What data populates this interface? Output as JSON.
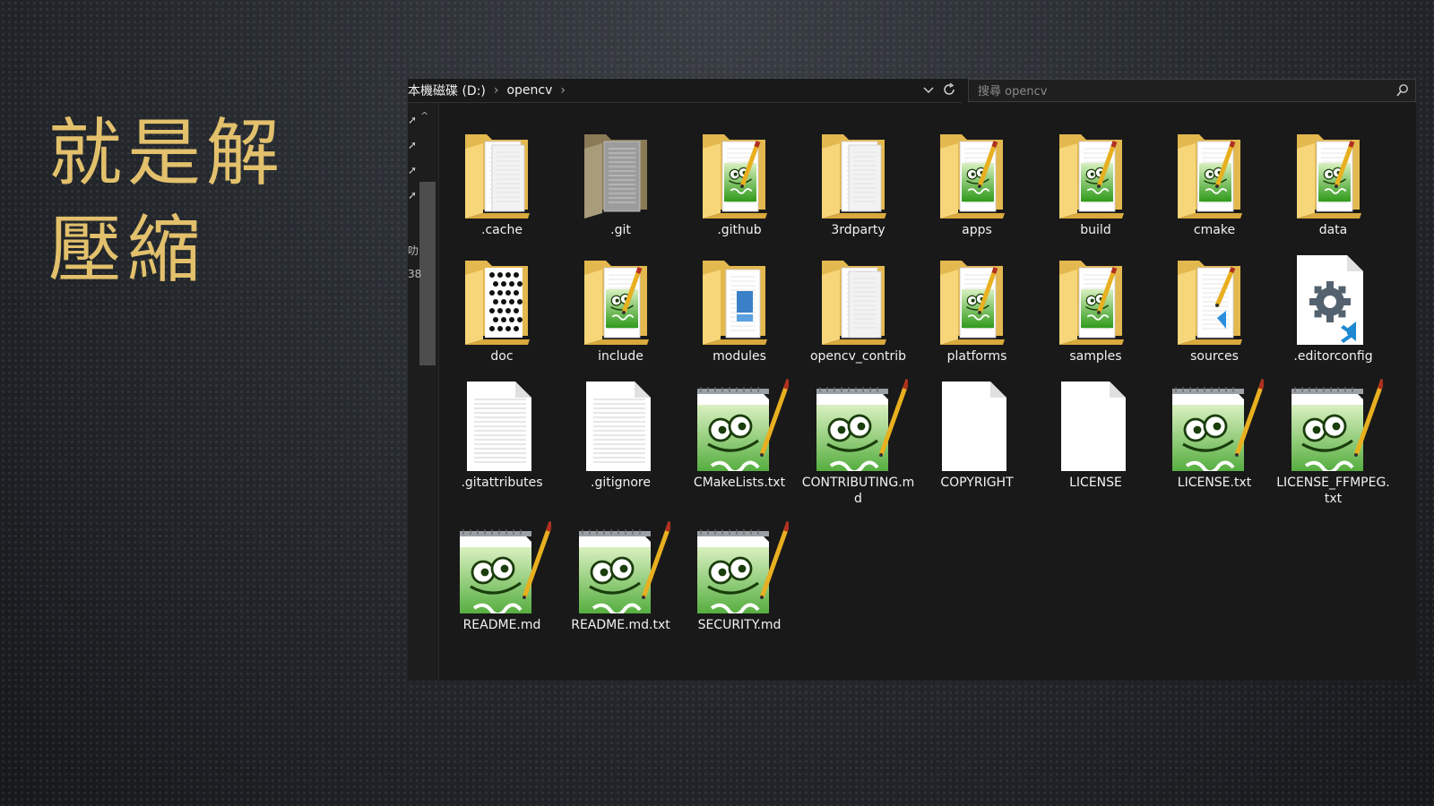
{
  "slide": {
    "title_line1": "就是解",
    "title_line2": "壓縮"
  },
  "explorer": {
    "breadcrumb": [
      "本機磁碟 (D:)",
      "opencv"
    ],
    "search_placeholder": "搜尋 opencv",
    "nav_stub_1": "叻",
    "nav_stub_2": "38",
    "items": [
      {
        "label": ".cache",
        "icon": "folder-doc-icon"
      },
      {
        "label": ".git",
        "icon": "folder-gray-icon"
      },
      {
        "label": ".github",
        "icon": "folder-notepad-icon"
      },
      {
        "label": "3rdparty",
        "icon": "folder-doc-icon"
      },
      {
        "label": "apps",
        "icon": "folder-notepad-icon"
      },
      {
        "label": "build",
        "icon": "folder-notepad-icon"
      },
      {
        "label": "cmake",
        "icon": "folder-notepad-icon"
      },
      {
        "label": "data",
        "icon": "folder-notepad-icon"
      },
      {
        "label": "doc",
        "icon": "folder-dots-icon"
      },
      {
        "label": "include",
        "icon": "folder-notepad-icon"
      },
      {
        "label": "modules",
        "icon": "folder-blue-icon"
      },
      {
        "label": "opencv_contrib",
        "icon": "folder-doc-icon"
      },
      {
        "label": "platforms",
        "icon": "folder-notepad-icon"
      },
      {
        "label": "samples",
        "icon": "folder-notepad-icon"
      },
      {
        "label": "sources",
        "icon": "folder-vscode-icon"
      },
      {
        "label": ".editorconfig",
        "icon": "vscode-settings-file-icon"
      },
      {
        "label": ".gitattributes",
        "icon": "text-file-icon"
      },
      {
        "label": ".gitignore",
        "icon": "text-file-icon"
      },
      {
        "label": "CMakeLists.txt",
        "icon": "notepadpp-file-icon"
      },
      {
        "label": "CONTRIBUTING.md",
        "icon": "notepadpp-file-icon"
      },
      {
        "label": "COPYRIGHT",
        "icon": "blank-file-icon"
      },
      {
        "label": "LICENSE",
        "icon": "blank-file-icon"
      },
      {
        "label": "LICENSE.txt",
        "icon": "notepadpp-file-icon"
      },
      {
        "label": "LICENSE_FFMPEG.txt",
        "icon": "notepadpp-file-icon"
      },
      {
        "label": "README.md",
        "icon": "notepadpp-file-icon"
      },
      {
        "label": "README.md.txt",
        "icon": "notepadpp-file-icon"
      },
      {
        "label": "SECURITY.md",
        "icon": "notepadpp-file-icon"
      }
    ]
  }
}
